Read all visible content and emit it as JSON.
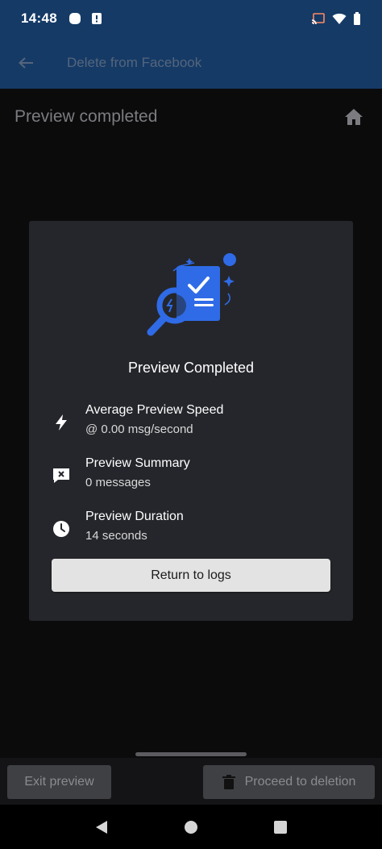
{
  "status_bar": {
    "time": "14:48",
    "icons": [
      "notification-circle-icon",
      "alert-icon",
      "cast-icon",
      "wifi-icon",
      "battery-icon"
    ]
  },
  "app_bar": {
    "title": "Delete from Facebook",
    "back_icon": "arrow-left-icon"
  },
  "page_header": {
    "title": "Preview completed",
    "home_icon": "home-icon"
  },
  "dialog": {
    "title": "Preview Completed",
    "stats": [
      {
        "icon": "lightning-icon",
        "label": "Average Preview Speed",
        "value": "@ 0.00 msg/second"
      },
      {
        "icon": "message-x-icon",
        "label": "Preview Summary",
        "value": "0 messages"
      },
      {
        "icon": "clock-icon",
        "label": "Preview Duration",
        "value": "14 seconds"
      }
    ],
    "return_label": "Return to logs"
  },
  "bottom_bar": {
    "exit_label": "Exit preview",
    "proceed_label": "Proceed to deletion",
    "proceed_icon": "trash-icon"
  },
  "colors": {
    "app_bar": "#153a66",
    "accent": "#2f6be6",
    "dialog_bg": "#25262b",
    "page_bg": "#0b0b0c"
  }
}
